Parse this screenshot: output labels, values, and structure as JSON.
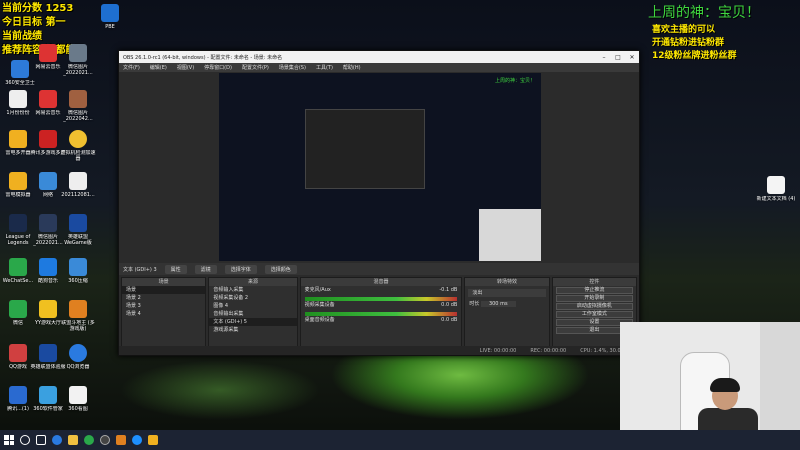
{
  "overlay_left": {
    "line1": "当前分数 1253",
    "line2": "今日目标 第一",
    "line3": "当前战绩",
    "line4": "推荐阵容 谈都能玩"
  },
  "overlay_right": {
    "title": "上周的神：宝贝！",
    "line1": "喜欢主播的可以",
    "line2": "开通钻粉进钻粉群",
    "line3": "12级粉丝牌进粉丝群"
  },
  "desktop_icons": [
    {
      "label": "360安全卫士"
    },
    {
      "label": "网易云音乐"
    },
    {
      "label": "微信图片_2022021..."
    },
    {
      "label": "PBE"
    },
    {
      "label": "1月份份份"
    },
    {
      "label": "网易云音乐"
    },
    {
      "label": "微信图片_2022042..."
    },
    {
      "label": "雷电多开器"
    },
    {
      "label": "腾讯多游戏多开"
    },
    {
      "label": "虚拟机检测加速器"
    },
    {
      "label": "雷电模拟器"
    },
    {
      "label": "网络"
    },
    {
      "label": "202112081..."
    },
    {
      "label": "League of Legends"
    },
    {
      "label": "微信图片_2022021..."
    },
    {
      "label": "英雄联盟WeGame版"
    },
    {
      "label": "WeChatSe..."
    },
    {
      "label": "酷狗音乐"
    },
    {
      "label": "360压缩"
    },
    {
      "label": "微信"
    },
    {
      "label": "YY游戏大厅"
    },
    {
      "label": "联盟斗地主 (多游戏版)"
    },
    {
      "label": "QQ游戏"
    },
    {
      "label": "英雄联盟体验服"
    },
    {
      "label": "QQ浏览器"
    },
    {
      "label": "腾讯...(1)"
    },
    {
      "label": "360软件管家"
    },
    {
      "label": "360看图"
    },
    {
      "label": "新建文本文档 (4)"
    }
  ],
  "obs": {
    "title": "OBS 26.1.0-rc1 (64-bit, windows) - 配置文件: 未命名 - 场景: 未命名",
    "menu": [
      "文件(F)",
      "编辑(E)",
      "视图(V)",
      "停靠窗口(D)",
      "配置文件(P)",
      "场景集合(S)",
      "工具(T)",
      "帮助(H)"
    ],
    "source_bar": {
      "selected": "文本 (GDI+) 3",
      "properties": "属性",
      "filters": "滤镜",
      "select_font": "选择字体",
      "select_color": "选择颜色"
    },
    "docks": {
      "scenes_header": "场景",
      "scenes": [
        "场景",
        "场景 2",
        "场景 3",
        "场景 4"
      ],
      "sources_header": "来源",
      "sources": [
        "音频输入采集",
        "视频采集设备 2",
        "图像 4",
        "音频输出采集",
        "文本 (GDI+) 5",
        "游戏源采集"
      ],
      "mixer_header": "混音器",
      "mixer": [
        {
          "name": "麦克风/Aux",
          "level": "-0.1 dB"
        },
        {
          "name": "视频采集设备",
          "level": "0.0 dB"
        },
        {
          "name": "桌面音频设备",
          "level": "0.0 dB"
        }
      ],
      "transitions_header": "转场特效",
      "transition_type": "淡出",
      "duration_label": "时长",
      "duration_value": "300 ms",
      "controls_header": "控件",
      "controls": [
        "停止推流",
        "开始录制",
        "启动虚拟摄像机",
        "工作室模式",
        "设置",
        "退出"
      ]
    },
    "status": {
      "live": "LIVE: 00:00:00",
      "rec": "REC: 00:00:00",
      "cpu": "CPU: 1.4%, 30.00 fps"
    }
  },
  "taskbar_icons": [
    "search-icon",
    "task-view-icon",
    "browser-icon",
    "explorer-icon",
    "wechat-icon",
    "obs-icon",
    "app-icon",
    "qq-icon"
  ]
}
